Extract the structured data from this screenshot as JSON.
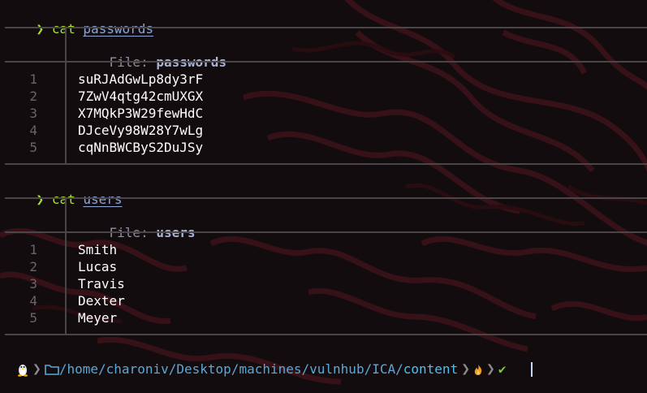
{
  "session": {
    "prompt_symbol": "❯",
    "cmd_word": "cat"
  },
  "blocks": [
    {
      "arg": "passwords",
      "file_label": "File:",
      "file_name": "passwords",
      "lines": [
        {
          "n": "1",
          "text": "suRJAdGwLp8dy3rF"
        },
        {
          "n": "2",
          "text": "7ZwV4qtg42cmUXGX"
        },
        {
          "n": "3",
          "text": "X7MQkP3W29fewHdC"
        },
        {
          "n": "4",
          "text": "DJceVy98W28Y7wLg"
        },
        {
          "n": "5",
          "text": "cqNnBWCByS2DuJSy"
        }
      ]
    },
    {
      "arg": "users",
      "file_label": "File:",
      "file_name": "users",
      "lines": [
        {
          "n": "1",
          "text": "Smith"
        },
        {
          "n": "2",
          "text": "Lucas"
        },
        {
          "n": "3",
          "text": "Travis"
        },
        {
          "n": "4",
          "text": "Dexter"
        },
        {
          "n": "5",
          "text": "Meyer"
        }
      ]
    }
  ],
  "statusbar": {
    "os_icon": "linux-tux-icon",
    "folder_icon": "folder-icon",
    "path_parts": [
      "home",
      "charoniv",
      "Desktop",
      "machines",
      "vulnhub",
      "ICA",
      "content"
    ],
    "flame_icon": "flame-icon",
    "check_icon": "check-icon",
    "check_symbol": "✔",
    "separator": "❯"
  },
  "colors": {
    "background": "#120c0f",
    "prompt_green": "#a6e22e",
    "argument_blue": "#8fa7d6",
    "path_blue": "#5aa8d6",
    "rule_gray": "#4a4547"
  }
}
